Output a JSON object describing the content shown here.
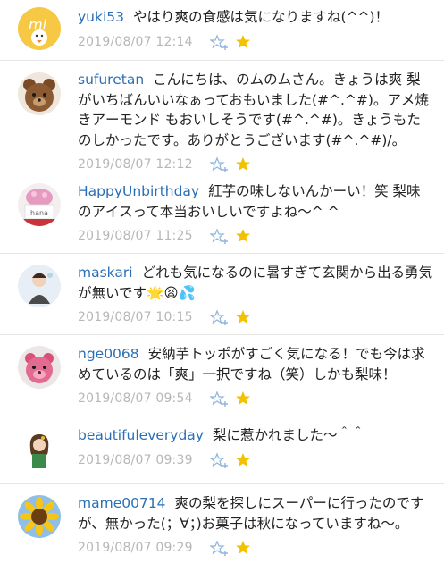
{
  "colors": {
    "username": "#2a6fb5",
    "date": "#b7b7b7",
    "star": "#f2c200",
    "react_icon": "#8fb5dd",
    "divider": "#e6e6e6"
  },
  "comments": [
    {
      "user": "yuki53",
      "text": "やはり爽の食感は気になりますね(^^)！",
      "date": "2019/08/07 12:14",
      "avatar_icon": "mi-logo-icon"
    },
    {
      "user": "sufuretan",
      "text": "こんにちは、のムのムさん。きょうは爽 梨がいちばんいいなぁっておもいました(#^.^#)。アメ焼きアーモンド もおいしそうです(#^.^#)。きょうもたのしかったです。ありがとうございます(#^.^#)/。",
      "date": "2019/08/07 12:12",
      "avatar_icon": "teddy-bear-icon"
    },
    {
      "user": "HappyUnbirthday",
      "text": "紅芋の味しないんかーい！笑 梨味のアイスって本当おいしいですよね〜^ ^",
      "date": "2019/08/07 11:25",
      "avatar_icon": "cupcake-icon",
      "avatar_text": "hana"
    },
    {
      "user": "maskari",
      "text": "どれも気になるのに暑すぎて玄関から出る勇気が無いです🌟😫💦",
      "date": "2019/08/07 10:15",
      "avatar_icon": "person-illustration-icon"
    },
    {
      "user": "nge0068",
      "text": "安納芋トッポがすごく気になる！でも今は求めているのは「爽」一択ですね（笑）しかも梨味！",
      "date": "2019/08/07 09:54",
      "avatar_icon": "pink-bear-icon"
    },
    {
      "user": "beautifuleveryday",
      "text": "梨に惹かれました〜＾＾",
      "date": "2019/08/07 09:39",
      "avatar_icon": "girl-illustration-icon"
    },
    {
      "user": "mame00714",
      "text": "爽の梨を探しにスーパーに行ったのですが、無かった(；∀；)お菓子は秋になっていますね〜。",
      "date": "2019/08/07 09:29",
      "avatar_icon": "sunflower-icon"
    }
  ]
}
